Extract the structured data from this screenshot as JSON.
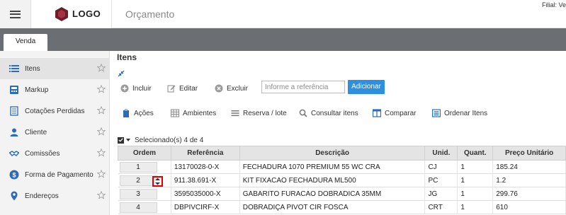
{
  "header": {
    "logo_text": "LOGO",
    "page_title": "Orçamento",
    "filial_label": "Filial: Ve"
  },
  "tabs": [
    {
      "label": "Venda"
    }
  ],
  "sidebar": {
    "items": [
      {
        "label": "Itens",
        "icon": "list-icon",
        "active": true
      },
      {
        "label": "Markup",
        "icon": "calculator-icon"
      },
      {
        "label": "Cotações Perdidas",
        "icon": "document-icon"
      },
      {
        "label": "Cliente",
        "icon": "user-icon"
      },
      {
        "label": "Comissões",
        "icon": "handshake-icon"
      },
      {
        "label": "Forma de Pagamento",
        "icon": "dollar-icon"
      },
      {
        "label": "Endereços",
        "icon": "map-pin-icon"
      }
    ]
  },
  "main": {
    "section_title": "Itens",
    "toolbar1": {
      "incluir": "Incluir",
      "editar": "Editar",
      "excluir": "Excluir"
    },
    "reference": {
      "placeholder": "Informe a referência",
      "value": ""
    },
    "add_button": "Adicionar",
    "toolbar2": {
      "acoes": "Ações",
      "ambientes": "Ambientes",
      "reserva": "Reserva / lote",
      "consultar": "Consultar itens",
      "comparar": "Comparar",
      "ordenar": "Ordenar Itens"
    },
    "selection_text": "Selecionado(s) 4 de 4",
    "accent_color": "#2e8fe0",
    "highlight_color": "#e00000"
  },
  "table": {
    "headers": [
      "Ordem",
      "Referência",
      "Descrição",
      "Unid.",
      "Quant.",
      "Preço Unitário"
    ],
    "rows": [
      {
        "ordem": "1",
        "ref": "13170028-0-X",
        "desc": "FECHADURA 1070 PREMIUM 55 WC CRA",
        "unid": "CJ",
        "quant": "1",
        "preco": "185.24"
      },
      {
        "ordem": "2",
        "ref": "911.38.691-X",
        "desc": "KIT FIXACAO FECHADURA ML500",
        "unid": "PC",
        "quant": "1",
        "preco": "1.2"
      },
      {
        "ordem": "3",
        "ref": "3595035000-X",
        "desc": "GABARITO FURACAO DOBRADICA 35MM",
        "unid": "JG",
        "quant": "1",
        "preco": "299.76"
      },
      {
        "ordem": "4",
        "ref": "DBPIVCIRF-X",
        "desc": "DOBRADIÇA PIVOT CIR FOSCA",
        "unid": "CRT",
        "quant": "1",
        "preco": "610"
      }
    ]
  }
}
